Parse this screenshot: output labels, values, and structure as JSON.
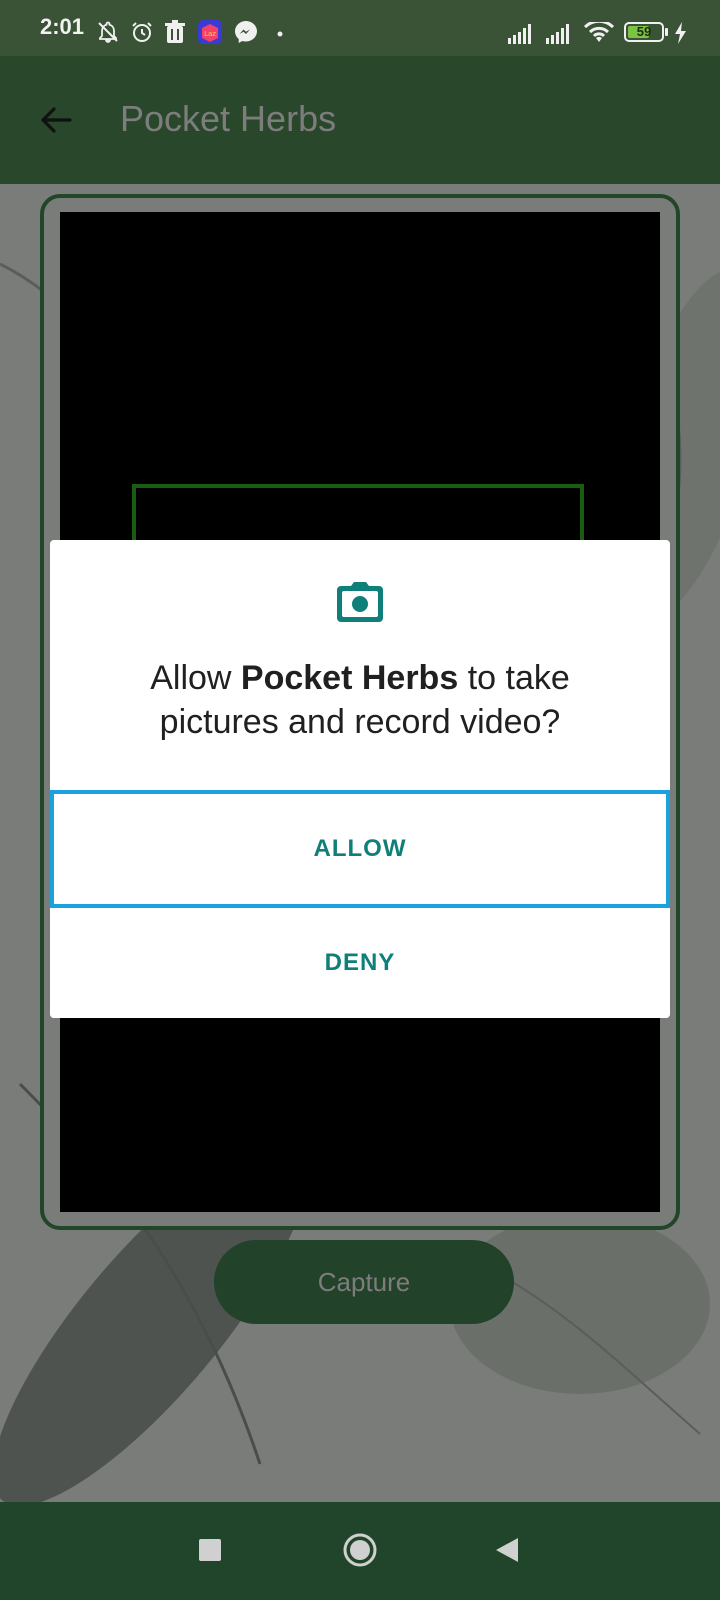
{
  "status_bar": {
    "time": "2:01",
    "battery_level": "59",
    "icons": [
      "notifications-off-icon",
      "alarm-icon",
      "trash-icon",
      "lazada-icon",
      "messenger-icon",
      "dot-icon",
      "signal-icon",
      "signal-icon",
      "wifi-icon",
      "battery-icon",
      "charging-icon"
    ]
  },
  "app_bar": {
    "title": "Pocket Herbs",
    "back_icon": "arrow-left-icon"
  },
  "camera": {
    "capture_label": "Capture"
  },
  "dialog": {
    "icon": "camera-icon",
    "message_prefix": "Allow ",
    "app_name": "Pocket Herbs",
    "message_suffix": " to take pictures and record video?",
    "allow_label": "ALLOW",
    "deny_label": "DENY"
  },
  "nav_bar": {
    "recents_icon": "square-icon",
    "home_icon": "circle-icon",
    "back_icon": "triangle-back-icon"
  },
  "colors": {
    "status_bar": "#3a5235",
    "app_bar": "#29472a",
    "nav_bar": "#21452b",
    "dialog_button_text": "#0f7f79",
    "focus_highlight": "#1aa2e0"
  }
}
